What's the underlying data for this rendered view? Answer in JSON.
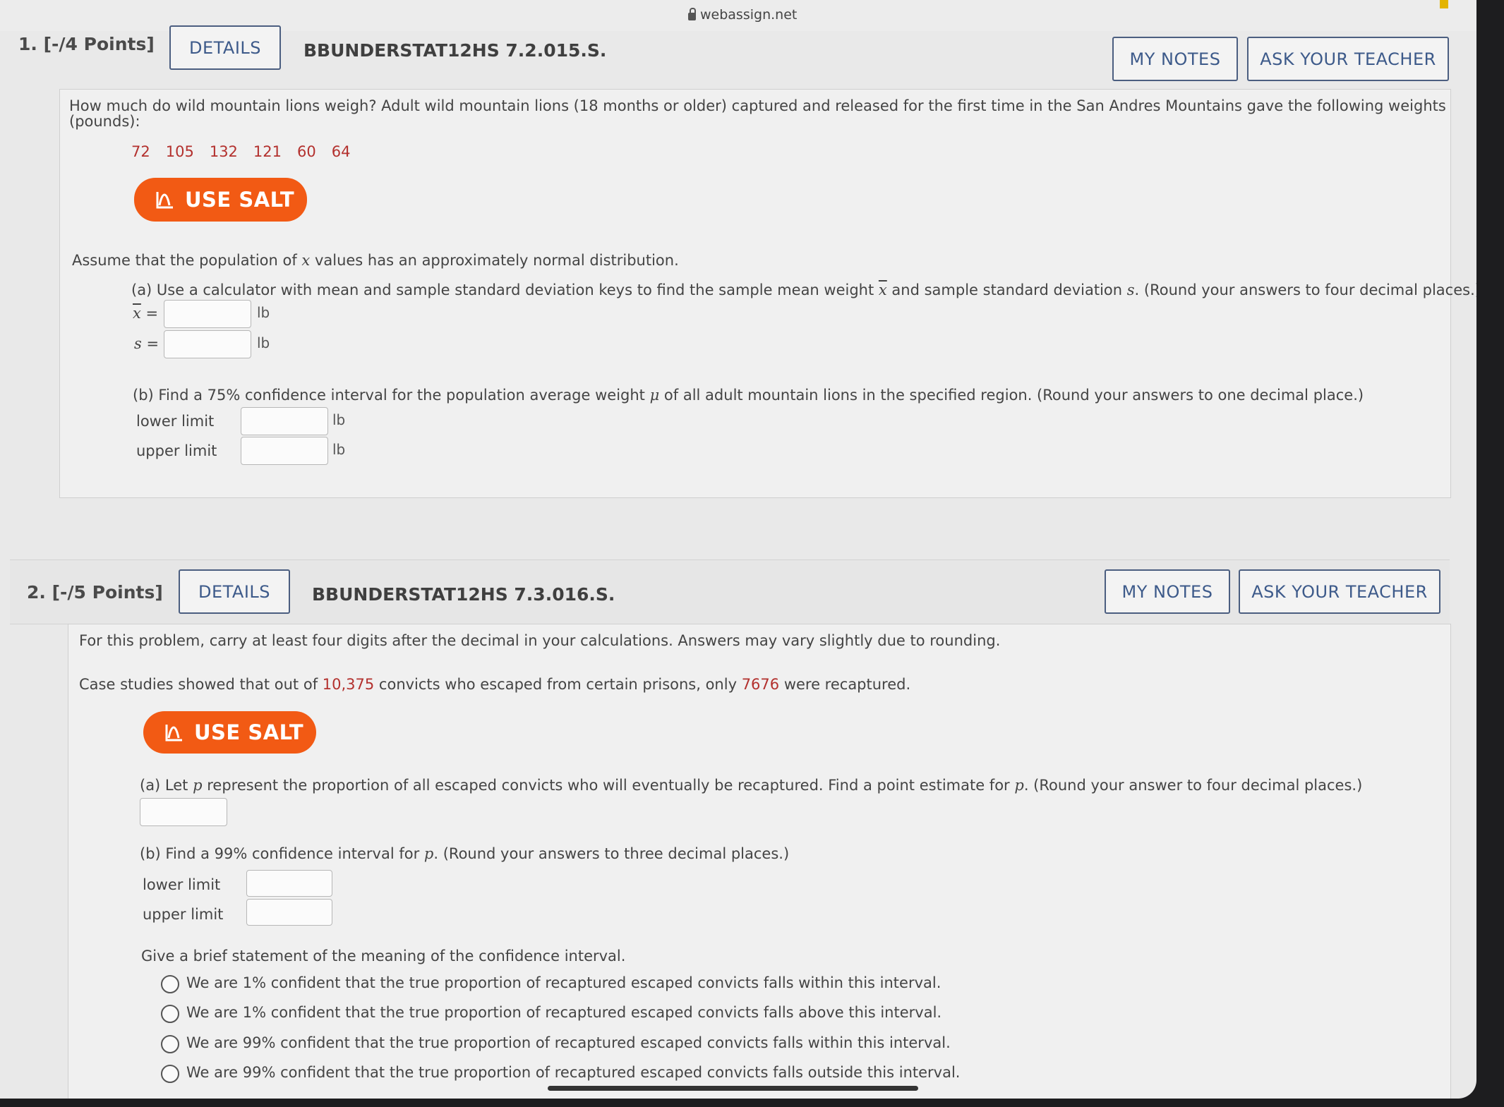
{
  "browser": {
    "url": "webassign.net"
  },
  "q1": {
    "number_label": "1.  [-/4 Points]",
    "details_label": "DETAILS",
    "code": "BBUNDERSTAT12HS 7.2.015.S.",
    "my_notes_label": "MY NOTES",
    "ask_teacher_label": "ASK YOUR TEACHER",
    "intro_line1": "How much do wild mountain lions weigh? Adult wild mountain lions (18 months or older) captured and released for the first time in the San Andres Mountains gave the following weights",
    "intro_line2": "(pounds):",
    "data": [
      "72",
      "105",
      "132",
      "121",
      "60",
      "64"
    ],
    "salt_label": "USE SALT",
    "assume_pre": "Assume that the population of ",
    "assume_var": "x",
    "assume_post": " values has an approximately normal distribution.",
    "part_a_pre": "(a) Use a calculator with mean and sample standard deviation keys to find the sample mean weight ",
    "part_a_xbar": "x",
    "part_a_mid": " and sample standard deviation ",
    "part_a_s": "s",
    "part_a_post": ". (Round your answers to four decimal places.)",
    "xbar_label": "x",
    "s_label": "s",
    "eq": "=",
    "unit": "lb",
    "xbar_value": "",
    "s_value": "",
    "part_b_pre": "(b) Find a 75% confidence interval for the population average weight ",
    "part_b_mu": "μ",
    "part_b_post": " of all adult mountain lions in the specified region. (Round your answers to one decimal place.)",
    "lower_label": "lower limit",
    "upper_label": "upper limit",
    "lower_value": "",
    "upper_value": ""
  },
  "q2": {
    "number_label": "2.  [-/5 Points]",
    "details_label": "DETAILS",
    "code": "BBUNDERSTAT12HS 7.3.016.S.",
    "my_notes_label": "MY NOTES",
    "ask_teacher_label": "ASK YOUR TEACHER",
    "note": "For this problem, carry at least four digits after the decimal in your calculations. Answers may vary slightly due to rounding.",
    "case_pre": "Case studies showed that out of ",
    "case_n": "10,375",
    "case_mid": " convicts who escaped from certain prisons, only ",
    "case_x": "7676",
    "case_post": " were recaptured.",
    "salt_label": "USE SALT",
    "part_a_pre": "(a) Let ",
    "part_a_p": "p",
    "part_a_mid": " represent the proportion of all escaped convicts who will eventually be recaptured. Find a point estimate for ",
    "part_a_p2": "p",
    "part_a_post": ". (Round your answer to four decimal places.)",
    "point_estimate_value": "",
    "part_b_pre": "(b) Find a 99% confidence interval for ",
    "part_b_p": "p",
    "part_b_post": ". (Round your answers to three decimal places.)",
    "lower_label": "lower limit",
    "upper_label": "upper limit",
    "lower_value": "",
    "upper_value": "",
    "statement_prompt": "Give a brief statement of the meaning of the confidence interval.",
    "options": [
      "We are 1% confident that the true proportion of recaptured escaped convicts falls within this interval.",
      "We are 1% confident that the true proportion of recaptured escaped convicts falls above this interval.",
      "We are 99% confident that the true proportion of recaptured escaped convicts falls within this interval.",
      "We are 99% confident that the true proportion of recaptured escaped convicts falls outside this interval."
    ]
  },
  "colors": {
    "salt": "#f25a14",
    "button_text": "#3d5a8a",
    "data_red": "#b3312e"
  }
}
